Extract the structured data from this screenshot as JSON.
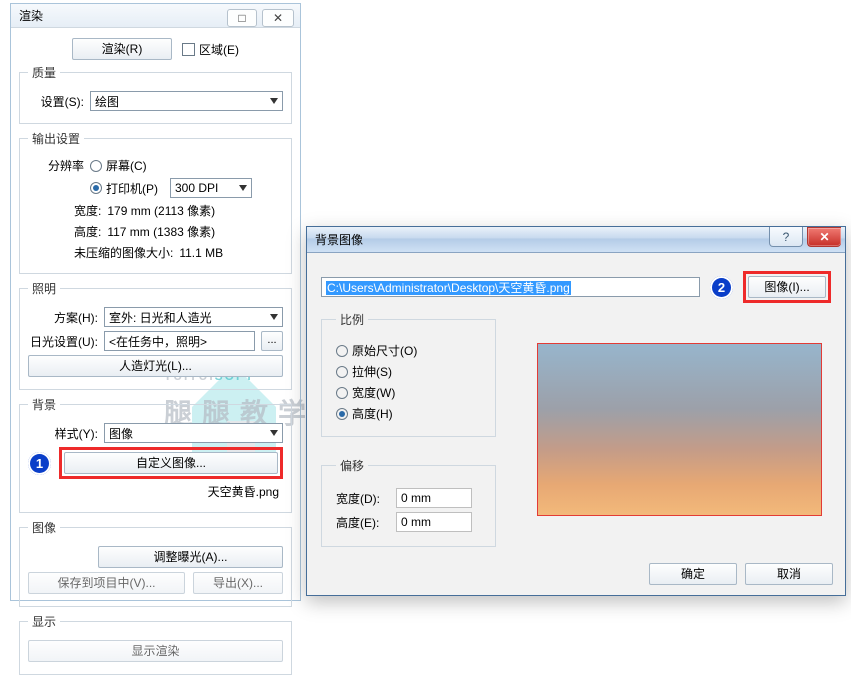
{
  "panel": {
    "title": "渲染",
    "pin": "□",
    "close": "✕",
    "render_btn": "渲染(R)",
    "area_label": "区域(E)",
    "quality": {
      "legend": "质量",
      "setting_label": "设置(S):",
      "setting_value": "绘图"
    },
    "output": {
      "legend": "输出设置",
      "resolution_label": "分辨率",
      "screen_label": "屏幕(C)",
      "printer_label": "打印机(P)",
      "dpi_value": "300 DPI",
      "width_label": "宽度:",
      "width_value": "179 mm (2113 像素)",
      "height_label": "高度:",
      "height_value": "117 mm (1383 像素)",
      "uncompressed_label": "未压缩的图像大小:",
      "uncompressed_value": "11.1 MB"
    },
    "lighting": {
      "legend": "照明",
      "scheme_label": "方案(H):",
      "scheme_value": "室外: 日光和人造光",
      "daylight_label": "日光设置(U):",
      "daylight_value": "<在任务中，照明>",
      "artificial_btn": "人造灯光(L)..."
    },
    "background": {
      "legend": "背景",
      "style_label": "样式(Y):",
      "style_value": "图像",
      "custom_btn": "自定义图像...",
      "filename": "天空黄昏.png"
    },
    "image": {
      "legend": "图像",
      "exposure_btn": "调整曝光(A)...",
      "save_btn": "保存到项目中(V)...",
      "export_btn": "导出(X)..."
    },
    "display": {
      "legend": "显示",
      "show_btn": "显示渲染"
    }
  },
  "dialog": {
    "title": "背景图像",
    "help": "?",
    "close": "✕",
    "path_value": "C:\\Users\\Administrator\\Desktop\\天空黄昏.png",
    "image_btn": "图像(I)...",
    "scale": {
      "legend": "比例",
      "original": "原始尺寸(O)",
      "stretch": "拉伸(S)",
      "width": "宽度(W)",
      "height": "高度(H)"
    },
    "offset": {
      "legend": "偏移",
      "width_label": "宽度(D):",
      "width_value": "0 mm",
      "height_label": "高度(E):",
      "height_value": "0 mm"
    },
    "ok": "确定",
    "cancel": "取消"
  },
  "callouts": {
    "one": "1",
    "two": "2"
  },
  "watermark": {
    "line1a": "TUITUI",
    "line1b": "SOFT",
    "line2": "腿腿教学网"
  }
}
